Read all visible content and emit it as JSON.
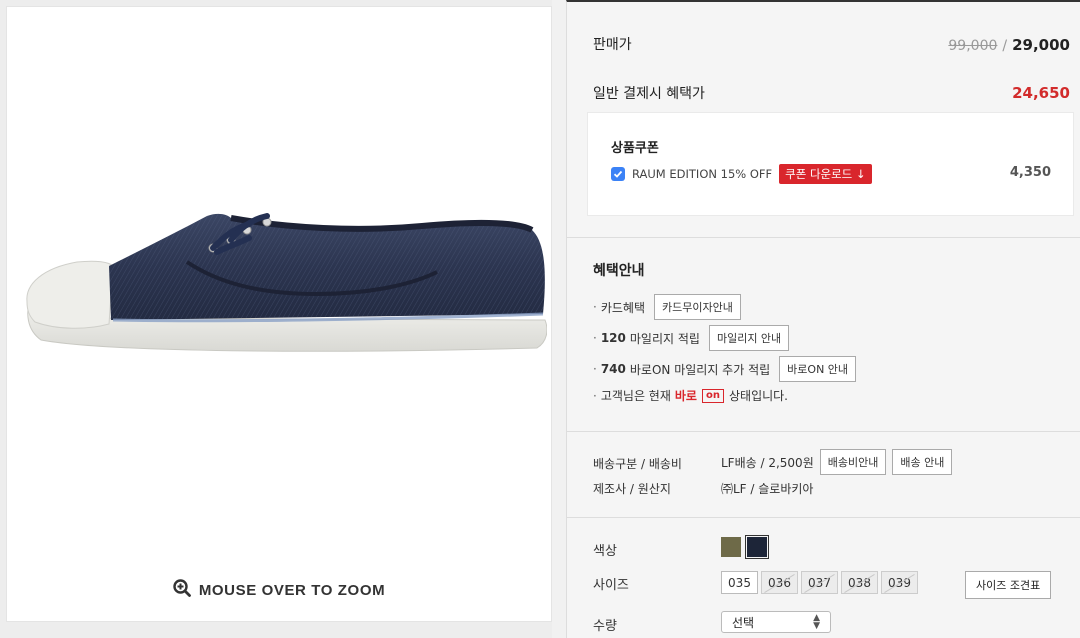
{
  "image": {
    "zoom_hint": "MOUSE OVER TO ZOOM",
    "zoom_icon": "magnifier-plus-icon"
  },
  "price": {
    "sale_label": "판매가",
    "original_price": "99,000",
    "separator": "/",
    "sale_price": "29,000",
    "benefit_label": "일반 결제시 혜택가",
    "benefit_price": "24,650"
  },
  "coupon": {
    "title": "상품쿠폰",
    "name": "RAUM EDITION 15% OFF",
    "download_label": "쿠폰 다운로드 ↓",
    "amount": "4,350",
    "checked": true
  },
  "benefits": {
    "title": "혜택안내",
    "card_label": "카드혜택",
    "card_button": "카드무이자안내",
    "mileage_amount": "120",
    "mileage_label": "마일리지 적립",
    "mileage_button": "마일리지 안내",
    "baro_amount": "740",
    "baro_label": "바로ON 마일리지 추가 적립",
    "baro_button": "바로ON 안내",
    "status_prefix": "고객님은 현재",
    "status_baro": "바로",
    "status_on": "on",
    "status_suffix": "상태입니다."
  },
  "shipping": {
    "label": "배송구분 / 배송비",
    "value": "LF배송 / 2,500원",
    "fee_button": "배송비안내",
    "info_button": "배송 안내",
    "maker_label": "제조사 / 원산지",
    "maker_value": "㈜LF / 슬로바키아"
  },
  "options": {
    "color_label": "색상",
    "colors": [
      "#6e6a48",
      "#1d2538"
    ],
    "selected_color": 1,
    "size_label": "사이즈",
    "sizes": [
      "035",
      "036",
      "037",
      "038",
      "039"
    ],
    "disabled_sizes": [
      "036",
      "037",
      "038",
      "039"
    ],
    "size_chart_button": "사이즈 조견표",
    "qty_label": "수량",
    "qty_value": "선택"
  }
}
